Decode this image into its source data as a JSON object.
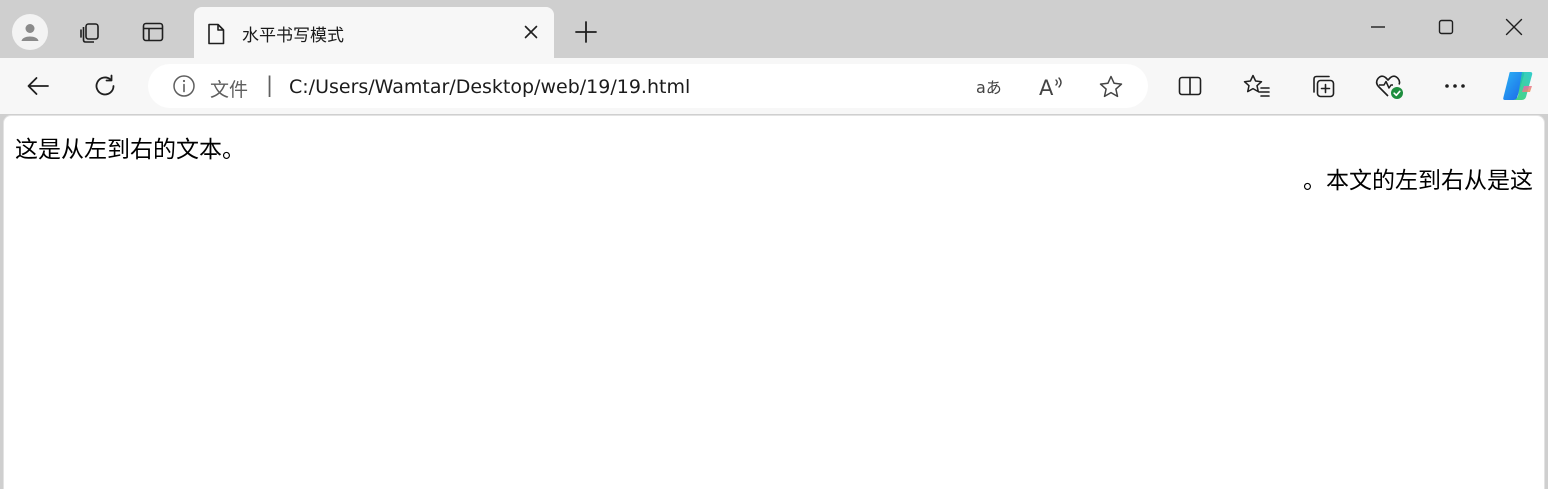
{
  "browser": {
    "tab": {
      "title": "水平书写模式"
    },
    "address_bar": {
      "scheme_label": "文件",
      "separator": "|",
      "url": "C:/Users/Wamtar/Desktop/web/19/19.html"
    },
    "icons": {
      "read_aloud_label": "A",
      "translate_label": "aあ"
    },
    "colors": {
      "tabstrip": "#cfcfcf",
      "toolbar": "#f7f7f7",
      "health_badge": "#1e8e3e"
    }
  },
  "page": {
    "ltr_text": "这是从左到右的文本。",
    "rtl_text": "这是从右到左的文本。"
  }
}
